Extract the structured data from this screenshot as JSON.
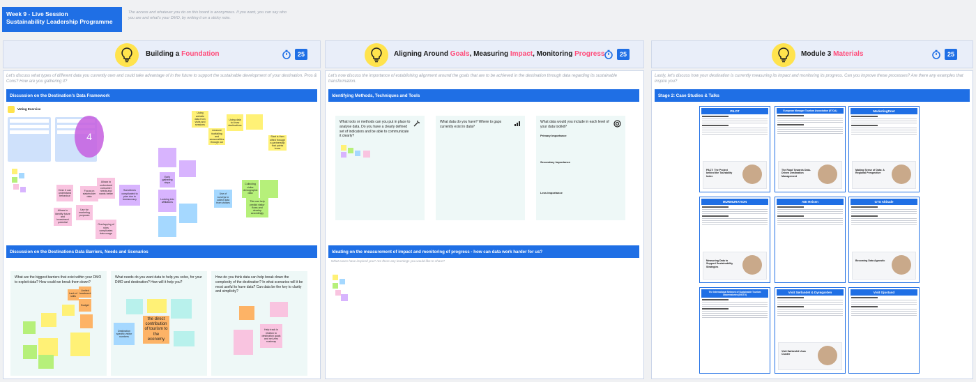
{
  "header": {
    "title_line1": "Week 9 - Live Session",
    "title_line2": "Sustainability Leadership Programme",
    "anonymity_note": "The access and whatever you do on this board is anonymous. If you want, you can say who you are and what's your DMO, by writing it on a sticky note."
  },
  "frames": [
    {
      "title_pre": "Building a ",
      "title_accent": "Foundation",
      "timer": "25",
      "question": "Let's discuss what types of different data you currently own and could take advantage of in the future to support the sustainable development of your destination. Pros & Cons? How are you gathering it?",
      "section1": "Discussion on the Destination's Data Framework",
      "voting_label": "Voting Exercise",
      "vote_count": "4",
      "section2": "Discussion on the Destinations Data Barriers, Needs and Scenarios",
      "col1_q": "What are the biggest barriers that exist within your DMO to exploit data? How could we break them down?",
      "col2_q": "What needs do you want data to help you solve, for your DMO and destination? How will it help you?",
      "col3_q": "How do you think data can help break down the complexity of the destination? In what scenarios will it be most useful to have data? Can data be the key to clarity and simplicity?",
      "stickies": {
        "s1": "Using website data from visits and sessions",
        "s2": "Using data to know destinations",
        "s3": "Allows to measure footfalling and seasonalities through our data",
        "s4": "Start is then sifted through a partnership that points know",
        "s5": "Dest: it can understand behaviour",
        "s6": "Allows to identify future and investment potential",
        "s7": "Focus on stakeholder data",
        "s8": "Allows to understand consumer needs and wants better",
        "s9": "Use for marketing purposes",
        "s10": "Overlapping of roles complicates data usage",
        "s11": "Sometimes complicated to plan due to bureaucracy",
        "s12": "Early gathering steps",
        "s13": "Looking into affiliations",
        "s14": "Collecting visitor demographic data",
        "s15": "Use of surveys to collect data from visitors",
        "s16": "This can help predict visitor flows and develop accordingly",
        "s17": "the direct contribution of tourism to the economy",
        "s18": "Destination specific visitor numbers",
        "s19": "Help track in relation to destination goals and net-zero roadmap",
        "s20": "Limited headcount",
        "s21": "Budget",
        "s22": "Lack of skills"
      }
    },
    {
      "title_pre": "Aligning Around ",
      "title_accent1": "Goals",
      "title_mid1": ", Measuring ",
      "title_accent2": "Impact",
      "title_mid2": ", Monitoring ",
      "title_accent3": "Progress",
      "timer": "25",
      "question": "Let's now discuss the importance of establishing alignment around the goals that are to be achieved in the destination through data regarding its sustainable transformation.",
      "section1": "Identifying Methods, Techniques and Tools",
      "col1_q": "What tools or methods can you put in place to analyse data. Do you have a clearly defined set of indicators and be able to communicate it clearly?",
      "col2_q": "What data do you have? Where to gaps currently exist in data?",
      "col3_q": "What data would you include in each level of your data toolkit?",
      "primary": "Primary Importance",
      "secondary": "Secondary Importance",
      "less": "Less Importance",
      "section2": "Ideating on the measurement of impact and monitoring of progress - how can data work harder for us?",
      "sub2": "What cases have inspired you? Are there any learnings you would like to share?"
    },
    {
      "title_pre": "Module 3 ",
      "title_accent": "Materials",
      "timer": "25",
      "question": "Lastly, let's discuss how your destination is currently measuring its impact and monitoring its progress. Can you improve these processes? Are there any examples that inspire you?",
      "section1": "Stage 2: Case Studies & Talks",
      "cases": [
        {
          "name": "PILOT",
          "talk": "PACT: The Project behind the Tourability Index"
        },
        {
          "name": "European Manager Tourism Association (ETOA)",
          "talk": "The Road Towards Data-Driven Destination Management"
        },
        {
          "name": "MarketingDnet",
          "talk": "Making Sense of Data: A Regional Perspective"
        },
        {
          "name": "MURMURATION",
          "talk": "Measuring Data to Support Sustainability Strategies"
        },
        {
          "name": "ABI Reisen",
          "talk": ""
        },
        {
          "name": "GTS Altitude",
          "talk": "Becoming Data Agnostic"
        },
        {
          "name": "The International Network of Sustainable Tourism Observatories (INSTO)",
          "talk": ""
        },
        {
          "name": "Visit Sørlandet & Dyrøgarden",
          "talk": "Visit Sørlandet Usus Cluster"
        },
        {
          "name": "Visit Gjustand",
          "talk": ""
        }
      ]
    }
  ]
}
